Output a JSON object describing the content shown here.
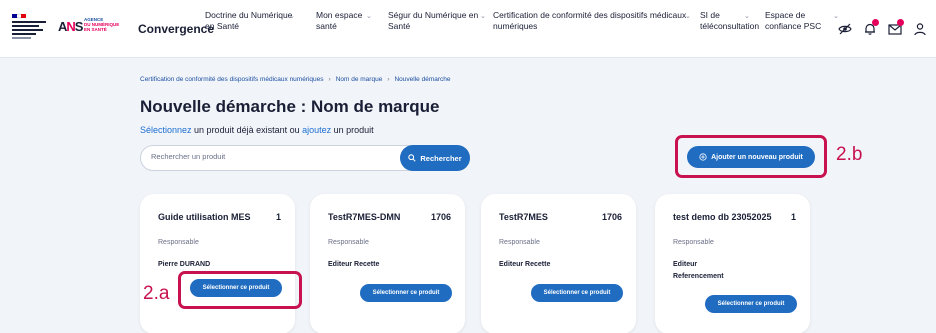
{
  "header": {
    "agency_logo_lines": [
      "Agence",
      "du Numérique",
      "en Santé"
    ],
    "brand": "Convergence",
    "nav": [
      {
        "label_line1": "Doctrine du Numérique",
        "label_line2": "en Santé"
      },
      {
        "label_line1": "Mon espace",
        "label_line2": "santé"
      },
      {
        "label_line1": "Ségur du Numérique en",
        "label_line2": "Santé"
      },
      {
        "label_line1": "Certification de conformité des dispositifs médicaux",
        "label_line2": "numériques"
      },
      {
        "label_line1": "SI de",
        "label_line2": "téléconsultation"
      },
      {
        "label_line1": "Espace de",
        "label_line2": "confiance PSC"
      }
    ],
    "icons": [
      "eye-off-icon",
      "bell-icon",
      "mail-icon",
      "user-icon"
    ],
    "notification_color": "#e5005b"
  },
  "breadcrumb": [
    "Certification de conformité des dispositifs médicaux numériques",
    "Nom de marque",
    "Nouvelle démarche"
  ],
  "page": {
    "title": "Nouvelle démarche : Nom de marque",
    "subtitle_link1": "Sélectionnez",
    "subtitle_mid": " un produit déjà existant ou ",
    "subtitle_link2": "ajoutez",
    "subtitle_end": " un produit"
  },
  "search": {
    "placeholder": "Rechercher un produit",
    "value": "",
    "button": "Rechercher"
  },
  "add_button": "Ajouter un nouveau produit",
  "annotations": {
    "add": "2.b",
    "select": "2.a"
  },
  "cards": [
    {
      "name": "Guide utilisation MES",
      "count": "1",
      "resp_label": "Responsable",
      "owner": [
        "Pierre DURAND"
      ],
      "button": "Sélectionner ce produit"
    },
    {
      "name": "TestR7MES-DMN",
      "count": "1706",
      "resp_label": "Responsable",
      "owner": [
        "Editeur Recette"
      ],
      "button": "Sélectionner ce produit"
    },
    {
      "name": "TestR7MES",
      "count": "1706",
      "resp_label": "Responsable",
      "owner": [
        "Editeur Recette"
      ],
      "button": "Sélectionner ce produit"
    },
    {
      "name": "test demo db 23052025",
      "count": "1",
      "resp_label": "Responsable",
      "owner": [
        "Editeur",
        "Referencement"
      ],
      "button": "Sélectionner ce produit"
    }
  ],
  "colors": {
    "accent": "#1f6cc0",
    "annotation": "#c8124f",
    "background": "#f1f4f9"
  }
}
